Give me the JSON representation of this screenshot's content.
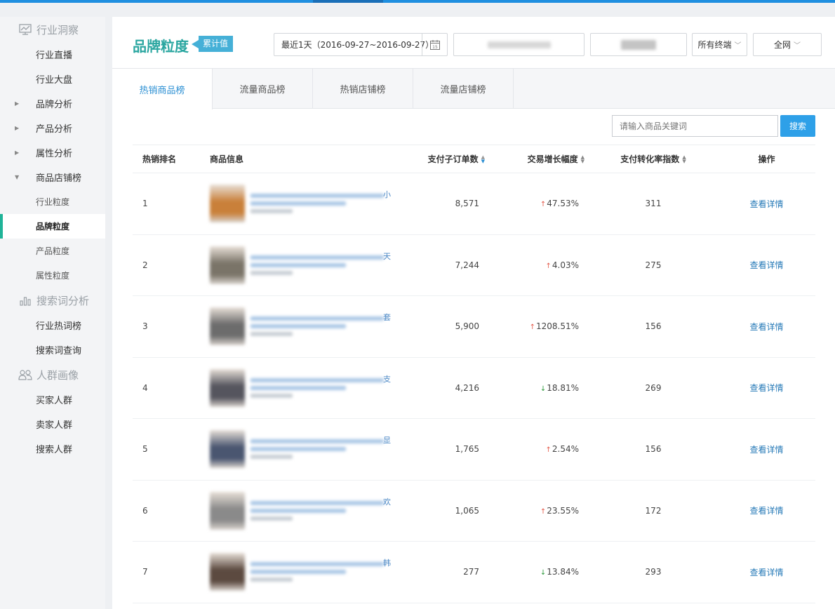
{
  "sidebar": {
    "sections": [
      {
        "title": "行业洞察",
        "icon": "monitor-chart-icon",
        "items": [
          "行业直播",
          "行业大盘"
        ]
      },
      {
        "expandable": [
          "品牌分析",
          "产品分析",
          "属性分析"
        ]
      },
      {
        "expanded": "商品店铺榜",
        "subs": [
          "行业粒度",
          "品牌粒度",
          "产品粒度",
          "属性粒度"
        ],
        "active": "品牌粒度"
      },
      {
        "title": "搜索词分析",
        "icon": "bar-chart-icon",
        "items": [
          "行业热词榜",
          "搜索词查询"
        ]
      },
      {
        "title": "人群画像",
        "icon": "users-icon",
        "items": [
          "买家人群",
          "卖家人群",
          "搜索人群"
        ]
      }
    ]
  },
  "header": {
    "title": "品牌粒度",
    "tag": "累计值",
    "date_range": "最近1天（2016-09-27~2016-09-27）",
    "calendar_day": "15",
    "terminal": "所有终端",
    "network": "全网"
  },
  "tabs": [
    "热销商品榜",
    "流量商品榜",
    "热销店铺榜",
    "流量店铺榜"
  ],
  "search": {
    "placeholder": "请输入商品关键词",
    "button": "搜索"
  },
  "table": {
    "headers": {
      "rank": "热销排名",
      "info": "商品信息",
      "orders": "支付子订单数",
      "growth": "交易增长幅度",
      "conversion": "支付转化率指数",
      "op": "操作"
    },
    "rows": [
      {
        "rank": "1",
        "edge": "小",
        "orders": "8,571",
        "growth": "47.53%",
        "dir": "up",
        "conv": "311",
        "op": "查看详情",
        "thumb": "#c9803a"
      },
      {
        "rank": "2",
        "edge": "天",
        "orders": "7,244",
        "growth": "4.03%",
        "dir": "up",
        "conv": "275",
        "op": "查看详情",
        "thumb": "#7a7468"
      },
      {
        "rank": "3",
        "edge": "套",
        "orders": "5,900",
        "growth": "1208.51%",
        "dir": "up",
        "conv": "156",
        "op": "查看详情",
        "thumb": "#6c6c6c"
      },
      {
        "rank": "4",
        "edge": "支",
        "orders": "4,216",
        "growth": "18.81%",
        "dir": "down",
        "conv": "269",
        "op": "查看详情",
        "thumb": "#55555e"
      },
      {
        "rank": "5",
        "edge": "显",
        "orders": "1,765",
        "growth": "2.54%",
        "dir": "up",
        "conv": "156",
        "op": "查看详情",
        "thumb": "#4a5670"
      },
      {
        "rank": "6",
        "edge": "欢",
        "orders": "1,065",
        "growth": "23.55%",
        "dir": "up",
        "conv": "172",
        "op": "查看详情",
        "thumb": "#8a8a8a"
      },
      {
        "rank": "7",
        "edge": "韩",
        "orders": "277",
        "growth": "13.84%",
        "dir": "down",
        "conv": "293",
        "op": "查看详情",
        "thumb": "#5c4a40"
      }
    ]
  },
  "colors": {
    "accent": "#2aa6a0",
    "link": "#2579b7",
    "up": "#e45a4a",
    "down": "#2e9a3c",
    "button": "#2ea0e8"
  }
}
